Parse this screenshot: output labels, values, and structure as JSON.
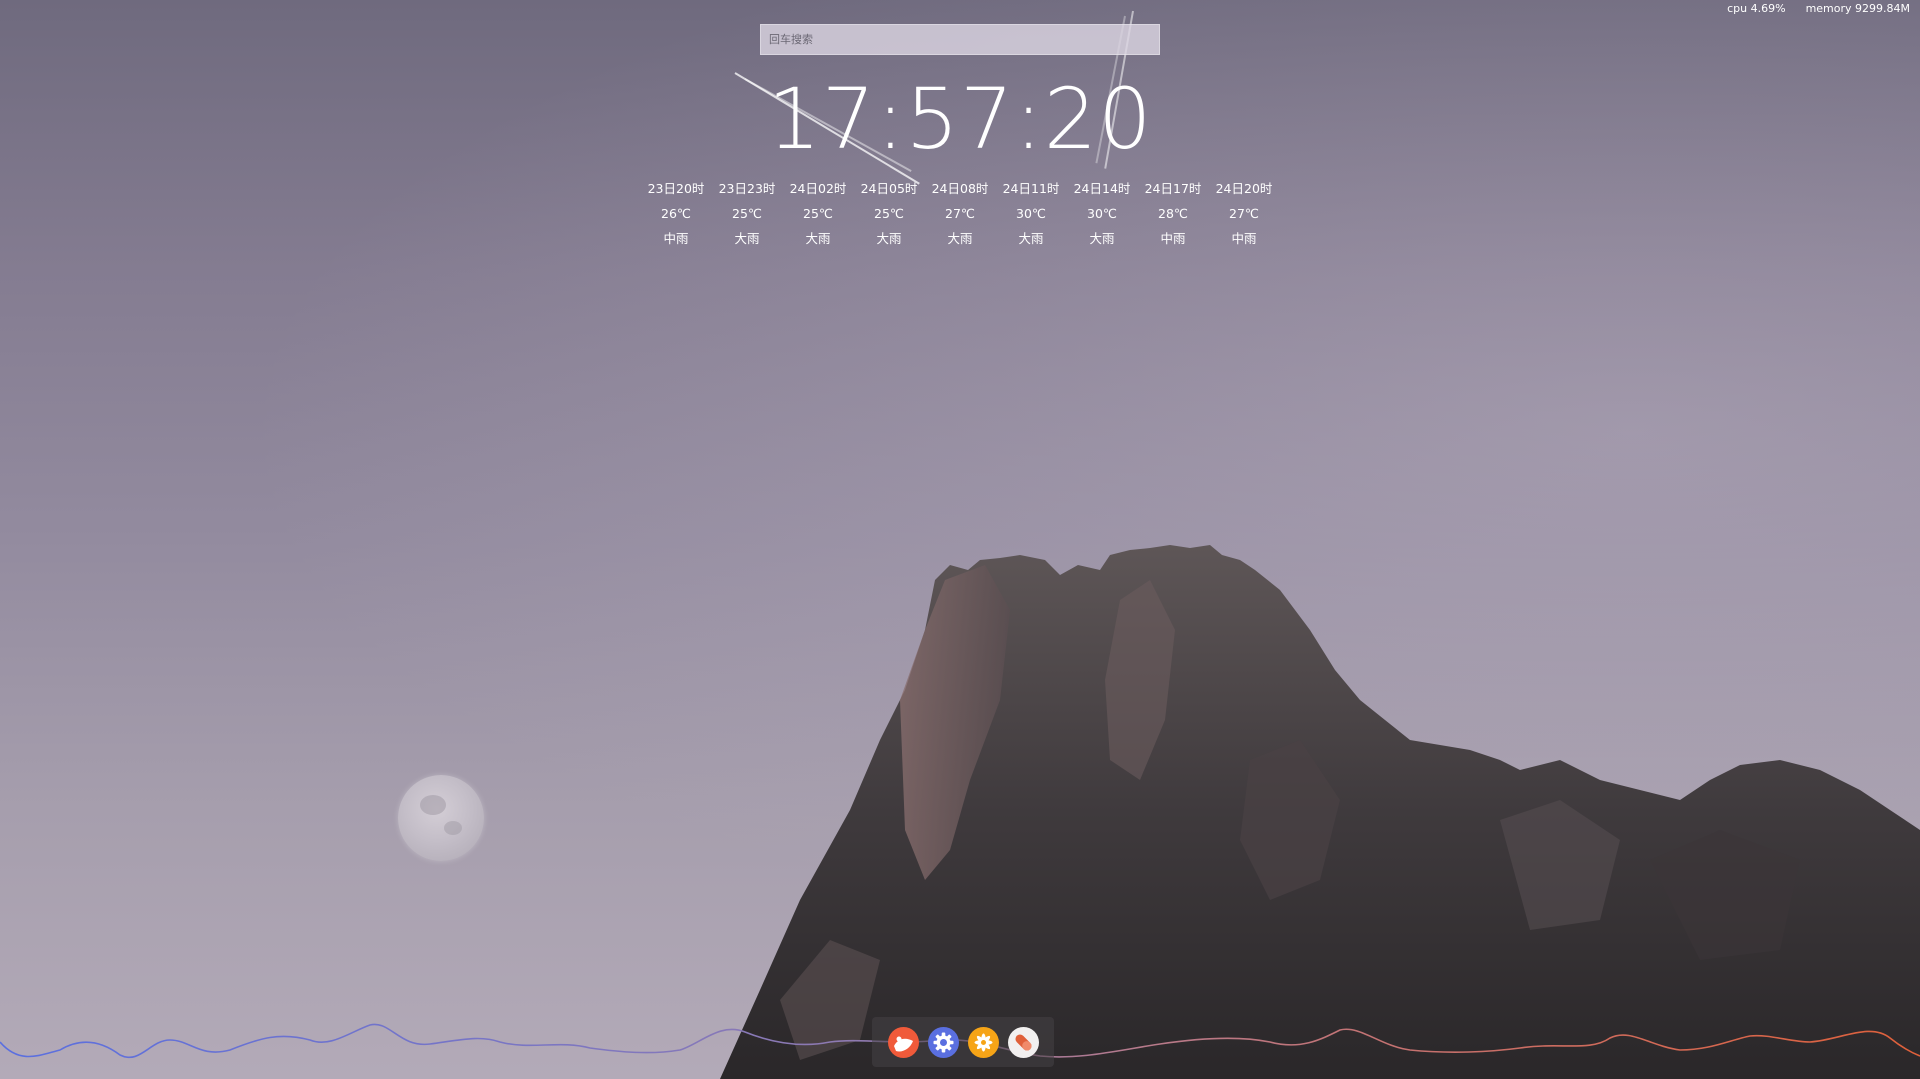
{
  "status": {
    "cpu": "cpu 4.69%",
    "memory": "memory 9299.84M"
  },
  "search": {
    "placeholder": "回车搜索",
    "value": ""
  },
  "clock": {
    "time": "17:57:20"
  },
  "forecast": [
    {
      "time": "23日20时",
      "temp": "26℃",
      "weather": "中雨"
    },
    {
      "time": "23日23时",
      "temp": "25℃",
      "weather": "大雨"
    },
    {
      "time": "24日02时",
      "temp": "25℃",
      "weather": "大雨"
    },
    {
      "time": "24日05时",
      "temp": "25℃",
      "weather": "大雨"
    },
    {
      "time": "24日08时",
      "temp": "27℃",
      "weather": "大雨"
    },
    {
      "time": "24日11时",
      "temp": "30℃",
      "weather": "大雨"
    },
    {
      "time": "24日14时",
      "temp": "30℃",
      "weather": "大雨"
    },
    {
      "time": "24日17时",
      "temp": "28℃",
      "weather": "中雨"
    },
    {
      "time": "24日20时",
      "temp": "27℃",
      "weather": "中雨"
    }
  ],
  "dock": {
    "apps": [
      {
        "icon": "red-app-icon",
        "color": "#f05a3a"
      },
      {
        "icon": "gear-icon",
        "color": "#5a6fe0"
      },
      {
        "icon": "flower-icon",
        "color": "#f6a417"
      },
      {
        "icon": "pill-icon",
        "color": "#f2f0f0"
      }
    ]
  },
  "colors": {
    "wave_left": "#5a6fe0",
    "wave_right": "#e0603a"
  }
}
